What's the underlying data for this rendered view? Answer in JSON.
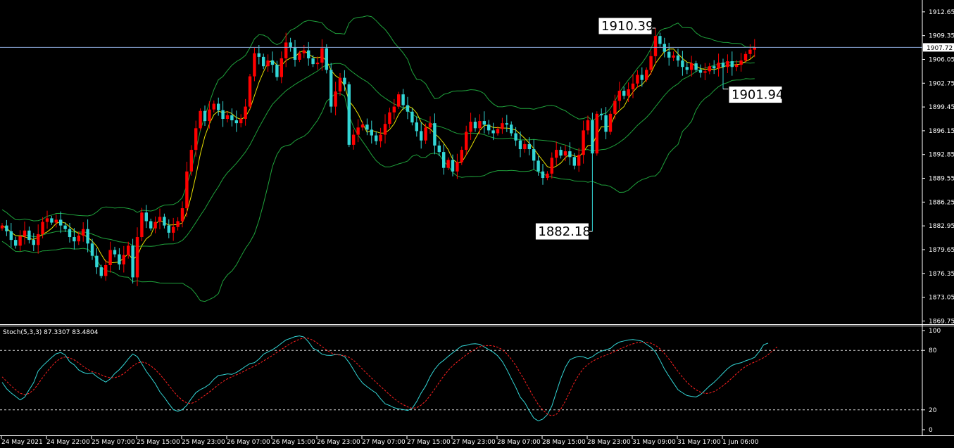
{
  "chart_data": {
    "type": "candlestick",
    "price_axis": {
      "ticks": [
        "1912.65",
        "1909.35",
        "1906.05",
        "1902.75",
        "1899.45",
        "1896.15",
        "1892.85",
        "1889.55",
        "1886.25",
        "1882.95",
        "1879.65",
        "1876.35",
        "1873.05",
        "1869.75"
      ],
      "range": [
        1869.3,
        1914.1
      ]
    },
    "current_price": "1907.72",
    "callouts": [
      {
        "label": "1910.39",
        "value": 1910.39,
        "bar": 145
      },
      {
        "label": "1901.94",
        "value": 1901.94,
        "bar": 160
      },
      {
        "label": "1882.18",
        "value": 1882.18,
        "bar": 131
      }
    ],
    "time_axis": [
      "24 May 2021",
      "24 May 22:00",
      "25 May 07:00",
      "25 May 15:00",
      "25 May 23:00",
      "26 May 07:00",
      "26 May 15:00",
      "26 May 23:00",
      "27 May 07:00",
      "27 May 15:00",
      "27 May 23:00",
      "28 May 07:00",
      "28 May 15:00",
      "28 May 23:00",
      "31 May 09:00",
      "31 May 17:00",
      "1 Jun 06:00"
    ],
    "closes": [
      1883.0,
      1882.2,
      1881.0,
      1880.2,
      1881.5,
      1882.3,
      1881.0,
      1880.3,
      1881.8,
      1883.5,
      1884.0,
      1883.4,
      1883.8,
      1883.0,
      1882.5,
      1881.4,
      1880.8,
      1881.6,
      1882.5,
      1880.5,
      1878.8,
      1877.2,
      1876.0,
      1877.5,
      1879.6,
      1879.0,
      1877.6,
      1878.9,
      1880.2,
      1875.8,
      1881.4,
      1884.8,
      1883.6,
      1882.6,
      1883.5,
      1884.2,
      1883.0,
      1882.0,
      1882.8,
      1883.6,
      1885.4,
      1890.5,
      1893.5,
      1896.5,
      1898.9,
      1897.5,
      1899.1,
      1899.9,
      1899.0,
      1897.8,
      1898.3,
      1897.6,
      1897.2,
      1897.8,
      1899.5,
      1903.7,
      1906.9,
      1906.4,
      1905.1,
      1905.9,
      1905.3,
      1903.6,
      1906.2,
      1908.4,
      1907.7,
      1906.0,
      1906.9,
      1907.3,
      1906.2,
      1905.4,
      1905.6,
      1907.6,
      1904.6,
      1899.5,
      1901.6,
      1903.5,
      1902.6,
      1894.2,
      1895.6,
      1896.6,
      1897.0,
      1896.3,
      1895.5,
      1894.7,
      1895.6,
      1897.1,
      1898.7,
      1899.5,
      1901.2,
      1899.7,
      1898.8,
      1897.3,
      1896.1,
      1894.8,
      1896.6,
      1897.2,
      1894.1,
      1893.2,
      1891.0,
      1892.1,
      1890.5,
      1891.8,
      1893.5,
      1896.0,
      1897.4,
      1896.5,
      1897.5,
      1897.0,
      1896.2,
      1895.8,
      1896.4,
      1897.2,
      1897.0,
      1895.8,
      1894.8,
      1893.6,
      1894.3,
      1893.6,
      1892.0,
      1890.5,
      1889.6,
      1890.2,
      1892.4,
      1893.5,
      1892.7,
      1893.3,
      1892.5,
      1891.3,
      1892.8,
      1896.2,
      1897.6,
      1893.0,
      1898.5,
      1898.3,
      1896.0,
      1898.5,
      1900.3,
      1901.7,
      1901.0,
      1901.9,
      1902.7,
      1903.9,
      1903.2,
      1904.6,
      1906.5,
      1909.3,
      1908.2,
      1907.1,
      1906.3,
      1906.6,
      1905.9,
      1905.0,
      1904.6,
      1905.5,
      1904.6,
      1904.2,
      1904.4,
      1905.1,
      1904.8,
      1905.6,
      1905.0,
      1905.8,
      1905.0,
      1905.3,
      1905.9,
      1906.8,
      1907.4,
      1907.72
    ],
    "indicator": {
      "name": "Stoch(5,3,3)",
      "values": [
        "87.3307",
        "83.4804"
      ],
      "ticks": [
        "100",
        "80",
        "20",
        "0"
      ],
      "levels": [
        80,
        20
      ],
      "main": [
        47.8,
        41.3,
        37.0,
        33.6,
        30.1,
        32.8,
        40.3,
        47.5,
        59.2,
        64.4,
        68.7,
        72.9,
        76.6,
        77.9,
        75.4,
        68.5,
        65.4,
        60.2,
        57.8,
        56.3,
        57.3,
        53.6,
        50.6,
        48.0,
        51.2,
        56.7,
        60.6,
        65.6,
        71.4,
        76.4,
        73.7,
        66.5,
        58.9,
        52.8,
        46.4,
        38.3,
        32.6,
        26.2,
        20.3,
        18.6,
        20.3,
        24.7,
        31.4,
        37.4,
        40.5,
        42.7,
        45.8,
        50.9,
        54.7,
        55.3,
        56.3,
        55.8,
        57.7,
        60.7,
        63.8,
        66.7,
        67.6,
        71.2,
        76.1,
        78.5,
        80.7,
        83.6,
        87.2,
        90.6,
        92.1,
        93.9,
        94.6,
        93.5,
        88.5,
        82.1,
        79.7,
        76.2,
        75.1,
        74.9,
        75.8,
        75.6,
        73.7,
        67.8,
        60.4,
        52.9,
        47.0,
        43.3,
        40.1,
        36.9,
        31.1,
        26.2,
        24.4,
        22.1,
        21.1,
        20.3,
        19.4,
        21.5,
        28.4,
        37.0,
        44.2,
        53.6,
        61.0,
        66.5,
        70.0,
        73.9,
        77.6,
        81.1,
        84.3,
        85.1,
        86.4,
        86.7,
        86.1,
        83.5,
        80.8,
        78.2,
        74.5,
        68.9,
        60.8,
        51.6,
        42.7,
        32.8,
        27.4,
        19.1,
        11.7,
        8.9,
        10.8,
        15.2,
        23.8,
        38.0,
        51.8,
        63.0,
        70.6,
        72.6,
        74.1,
        73.4,
        71.8,
        73.6,
        77.0,
        79.2,
        80.6,
        82.0,
        85.9,
        88.4,
        89.5,
        90.5,
        91.0,
        90.3,
        89.3,
        86.2,
        83.1,
        78.4,
        70.1,
        61.1,
        53.9,
        47.0,
        40.3,
        37.2,
        34.5,
        33.6,
        33.0,
        35.4,
        39.7,
        44.1,
        47.8,
        52.3,
        57.0,
        61.6,
        64.9,
        66.6,
        67.5,
        69.5,
        71.0,
        73.0,
        78.6,
        85.6,
        87.3307
      ],
      "signal": [
        53.3,
        48.8,
        44.2,
        40.3,
        36.8,
        35.3,
        36.6,
        40.3,
        46.1,
        52.6,
        58.7,
        64.1,
        68.8,
        72.0,
        73.4,
        72.4,
        70.4,
        67.3,
        63.8,
        60.9,
        58.5,
        57.1,
        55.4,
        53.5,
        52.4,
        52.5,
        53.9,
        56.5,
        60.3,
        64.3,
        67.2,
        68.3,
        67.2,
        64.4,
        60.6,
        55.8,
        50.5,
        44.8,
        38.9,
        33.7,
        29.7,
        26.9,
        26.5,
        28.4,
        31.4,
        34.7,
        38.1,
        41.7,
        45.4,
        48.5,
        51.3,
        53.4,
        55.4,
        57.4,
        59.7,
        62.0,
        64.2,
        66.6,
        69.3,
        72.1,
        75.0,
        78.0,
        81.0,
        84.2,
        86.9,
        89.2,
        91.3,
        92.5,
        92.2,
        90.2,
        87.1,
        83.8,
        80.4,
        77.5,
        76.0,
        75.1,
        74.8,
        73.0,
        70.0,
        65.6,
        60.9,
        56.4,
        52.0,
        47.8,
        43.6,
        39.5,
        35.2,
        31.3,
        28.0,
        25.3,
        23.0,
        21.6,
        22.1,
        24.8,
        28.9,
        34.5,
        40.9,
        47.7,
        54.1,
        59.8,
        64.4,
        68.4,
        72.0,
        75.5,
        78.6,
        81.5,
        83.7,
        84.6,
        84.9,
        84.5,
        83.2,
        80.8,
        76.7,
        71.3,
        64.7,
        57.1,
        49.2,
        40.8,
        32.8,
        25.3,
        19.9,
        15.7,
        14.0,
        15.5,
        20.8,
        28.9,
        38.4,
        47.7,
        55.4,
        61.7,
        65.9,
        68.9,
        71.4,
        73.5,
        75.1,
        77.0,
        79.1,
        81.2,
        83.2,
        85.0,
        86.6,
        87.8,
        88.3,
        88.2,
        87.2,
        85.1,
        81.7,
        76.9,
        71.2,
        65.0,
        58.8,
        52.9,
        47.7,
        43.6,
        40.2,
        37.9,
        36.6,
        36.9,
        38.5,
        41.1,
        44.4,
        48.1,
        52.3,
        56.5,
        60.5,
        63.8,
        66.2,
        68.3,
        70.3,
        72.6,
        75.7,
        79.8,
        83.4804
      ]
    },
    "colors": {
      "bull": "#ff0000",
      "bear": "#33d6d6",
      "bands": "#1fa33c",
      "ma": "#e8e000",
      "signal": "#ff2020",
      "level_line": "#ffffff",
      "price_line": "#8aa6d6"
    },
    "grid": false,
    "legend_position": "top-left"
  }
}
